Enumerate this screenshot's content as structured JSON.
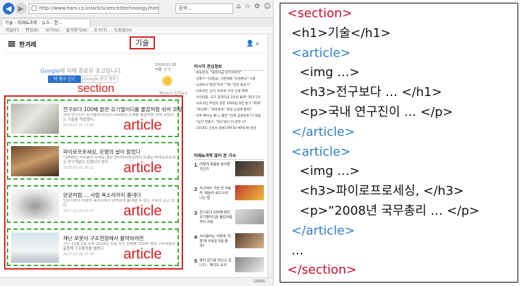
{
  "browser": {
    "url": "http://www.hani.co.kr/arti/science/technology/home01.html",
    "search_placeholder": "검색...",
    "tab_title": "기술 : 미래&과학 : 뉴스 : 한...",
    "menu": [
      "파일(F)",
      "편집(E)",
      "보기(V)",
      "즐겨찾기(A)",
      "도구(T)",
      "도움말(H)"
    ],
    "toolbar_icons": "⌂ ☆ ⚙ ☺",
    "zoom": "100%"
  },
  "site": {
    "logo": "한겨레",
    "h1_text": "기술",
    "ad_text_part1": "Google",
    "ad_text_part2": "에 의해 종료된 광고입니다.",
    "ad_button_stop": "이 광고 신고",
    "ad_button_why": "Google 광고 정보",
    "weather_date": "2018.01.05",
    "weather_city": "서울 -1°C",
    "subnav": "최신뉴스  인기뉴스"
  },
  "annotations": {
    "section_label": "section",
    "article_label": "article"
  },
  "articles": [
    {
      "title": "전구보다 100배 밝은 유기엘이디를 물감처럼 섞어 코팅",
      "desc": "국내 연구진이 유기발광다이오드(OLED) 소재를 물감처럼 섞어 코팅하는 기술을 개발했다.",
      "date": "2018-01-05 11:00"
    },
    {
      "title": "파이로프로세싱, 운명의 날이 밝았다",
      "desc": "“2008년 국무총리 주재로 열린 원자력위원회에서 의결된 파이로프로세싱 연구개발이 진행되어 왔다.",
      "date": "2018-01-03 16:22"
    },
    {
      "title": "양궁처럼…, 사람 목소리까지 흉내다",
      "desc": "인공지능이 사람의 목소리까지 완벽하게 흉내낼 수 있는 시대가 오고 있다.",
      "date": "2017-12-29 11:07"
    },
    {
      "title": "재난 로봇이 구조현장에서 활약하려면",
      "desc": "지난 11월 1일 오후 2016년 포항 지진 현장에 100여 명의 구조대원이 출동해 구조활동을 펼쳤다.",
      "date": "2017-12-25 14:29"
    }
  ],
  "sidebar": {
    "head1": "이시각 관심정보",
    "items": [
      "· 로또분석, \"출현지금 맞히지마라\"",
      "· 선풍수~10등급, 사판대를 \"소변판도\" 사용",
      "· 소변보고\"출현\"자처 \"\"에 \"검색 항공기\"",
      "· 비트코인 선거, 트트로 수익 인증 화제",
      "· 서민대출, 국가 정책자금 2조원 풀려! 최대 1억",
      "· 비트코인 부럽지 않은 2000원 8천 발기 \"화제\"",
      "· \"박장채\", \"로봇청와\" 창업 도극에 활짝?",
      "· 자주 빠지는 돌니, 몸한 \"전제 임플란트\"가 정답",
      "· \"남친 연중기, '작다'보다 더 굵은 이\"",
      "· 2018모 긴축서 목혹다파티의 40억 배 탄생"
    ],
    "head2": "미래&과학 많이 본 기사",
    "ranked": [
      {
        "num": "1",
        "text": "어떻게 죽음을 정의할 것인가"
      },
      {
        "num": "2",
        "text": "지구에서 가장 한 자동차 '테슬라 로드스터' 나는 법"
      },
      {
        "num": "3",
        "text": "전구보다 100배 밝은 유기엘이디를 물감처럼 섞어 코팅"
      },
      {
        "num": "4",
        "text": "식이용하는 어떻게 '미 경'에 이로운가를 졸까?"
      },
      {
        "num": "5",
        "text": "영리 금기를 대신고 섭니다 – 해녀도 요코"
      }
    ]
  },
  "code": {
    "lines": [
      {
        "text": "<section>",
        "color": "red",
        "indent": 0
      },
      {
        "text": "<h1>기술</h1>",
        "color": "black",
        "indent": 1
      },
      {
        "text": "<article>",
        "color": "blue",
        "indent": 1
      },
      {
        "text": "<img …>",
        "color": "black",
        "indent": 2
      },
      {
        "text": "<h3>전구보다 … </h1>",
        "color": "black",
        "indent": 2
      },
      {
        "text": "<p>국내 연구진이 … </p>",
        "color": "black",
        "indent": 2
      },
      {
        "text": "</article>",
        "color": "blue",
        "indent": 1
      },
      {
        "text": "<article>",
        "color": "blue",
        "indent": 1
      },
      {
        "text": "<img …>",
        "color": "black",
        "indent": 2
      },
      {
        "text": "<h3>파이로프로세싱, </h3>",
        "color": "black",
        "indent": 2
      },
      {
        "text": "<p>“2008년 국무총리 … </p>",
        "color": "black",
        "indent": 2
      },
      {
        "text": "</article>",
        "color": "blue",
        "indent": 1
      },
      {
        "text": "…",
        "color": "black",
        "indent": 1
      },
      {
        "text": "</section>",
        "color": "red",
        "indent": 0
      }
    ]
  },
  "colors": {
    "annotation_red": "#d42020",
    "article_green": "#3aa834",
    "code_red": "#c8102e",
    "code_blue": "#2f80c8"
  }
}
